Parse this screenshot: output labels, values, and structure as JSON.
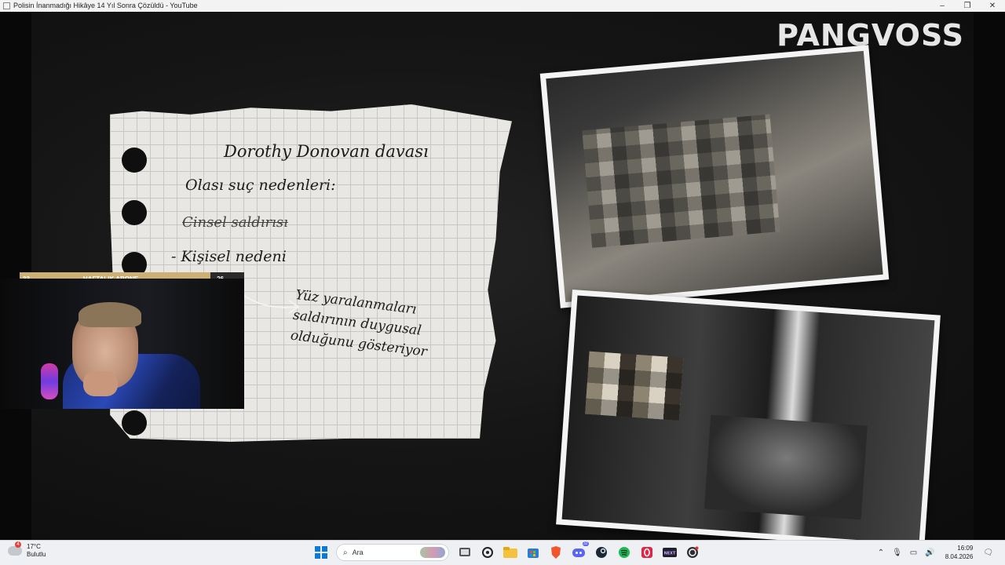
{
  "window": {
    "title": "Polisin İnanmadığı Hikâye 14 Yıl Sonra Çözüldü - YouTube",
    "minimize": "–",
    "maximize": "❐",
    "close": "✕"
  },
  "video": {
    "brand": "PANGVOSS",
    "note": {
      "title": "Dorothy Donovan davası",
      "subtitle": "Olası suç nedenleri:",
      "struck_item": "Cinsel saldırısı",
      "item": "- Kişisel nedeni",
      "explanation": [
        "Yüz yaralanmaları",
        "saldırının duygusal",
        "olduğunu gösteriyor"
      ]
    },
    "subscriber_goal": {
      "start": "23",
      "label": "HAFTALIK ABONE",
      "end": "26",
      "progress": 0.85
    }
  },
  "taskbar": {
    "weather": {
      "temp": "17°C",
      "condition": "Bulutlu",
      "alert_count": "4"
    },
    "search": {
      "placeholder": "Ara"
    },
    "apps": [
      "windows-start",
      "task-view",
      "steelseries",
      "file-explorer",
      "microsoft-store",
      "brave",
      "discord",
      "steam",
      "spotify",
      "opera",
      "kick",
      "obs"
    ],
    "discord_badge": "32",
    "clock": {
      "time": "16:09",
      "date": "8.04.2026"
    }
  },
  "colors": {
    "progress_fill": "#cdb074",
    "taskbar_bg": "#eef0f3",
    "paper": "#e9e7e3"
  }
}
